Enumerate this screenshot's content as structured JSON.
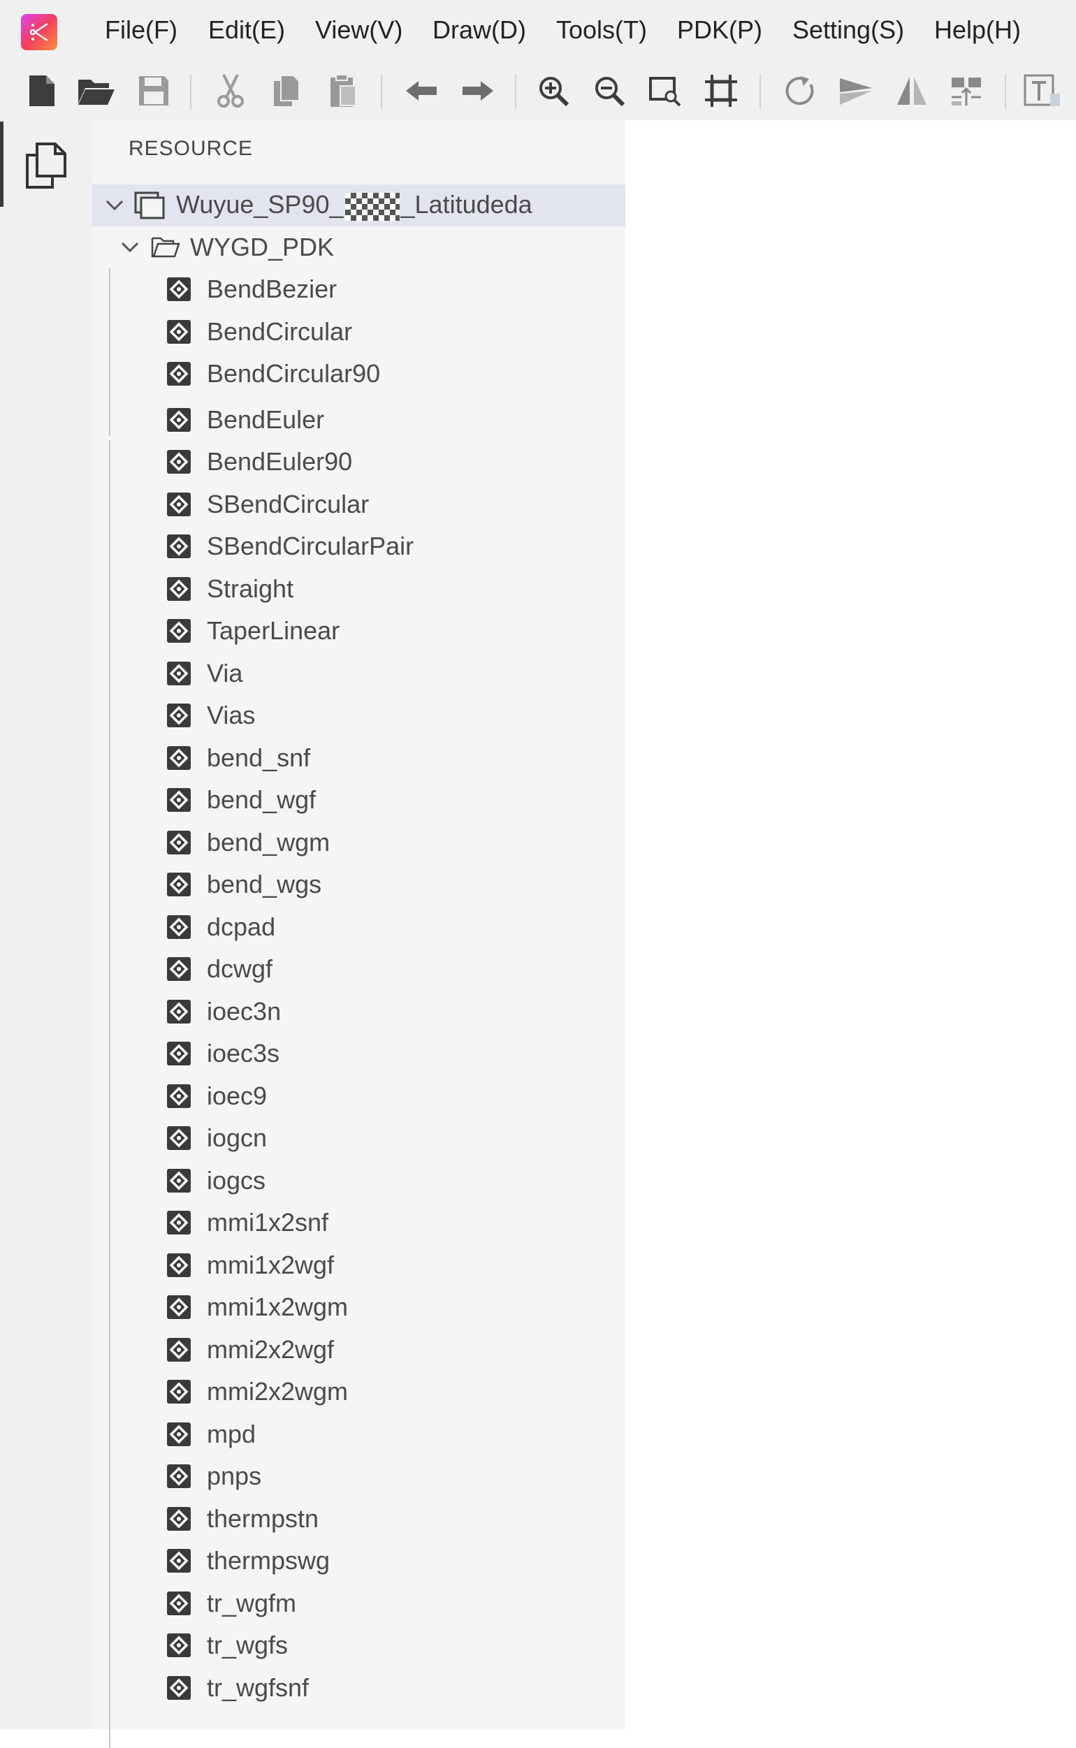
{
  "menubar": {
    "items": [
      "File(F)",
      "Edit(E)",
      "View(V)",
      "Draw(D)",
      "Tools(T)",
      "PDK(P)",
      "Setting(S)",
      "Help(H)"
    ]
  },
  "toolbar": {
    "icons": [
      "new-file-icon",
      "open-folder-icon",
      "save-icon",
      "cut-icon",
      "copy-icon",
      "paste-icon",
      "undo-icon",
      "redo-icon",
      "zoom-in-icon",
      "zoom-out-icon",
      "zoom-window-icon",
      "fit-view-icon",
      "rotate-icon",
      "flip-icon",
      "mirror-icon",
      "align-icon",
      "text-icon"
    ]
  },
  "activity": {
    "icons": [
      "copy-files-icon"
    ]
  },
  "resource": {
    "title": "RESOURCE",
    "project": {
      "name_prefix": "Wuyue_SP90_",
      "name_suffix": "_Latitudeda",
      "expanded": true,
      "selected": true
    },
    "folder": {
      "name": "WYGD_PDK",
      "expanded": true,
      "items": [
        "BendBezier",
        "BendCircular",
        "BendCircular90",
        "BendEuler",
        "BendEuler90",
        "SBendCircular",
        "SBendCircularPair",
        "Straight",
        "TaperLinear",
        "Via",
        "Vias",
        "bend_snf",
        "bend_wgf",
        "bend_wgm",
        "bend_wgs",
        "dcpad",
        "dcwgf",
        "ioec3n",
        "ioec3s",
        "ioec9",
        "iogcn",
        "iogcs",
        "mmi1x2snf",
        "mmi1x2wgf",
        "mmi1x2wgm",
        "mmi2x2wgf",
        "mmi2x2wgm",
        "mpd",
        "pnps",
        "thermpstn",
        "thermpswg",
        "tr_wgfm",
        "tr_wgfs",
        "tr_wgfsnf"
      ]
    }
  }
}
